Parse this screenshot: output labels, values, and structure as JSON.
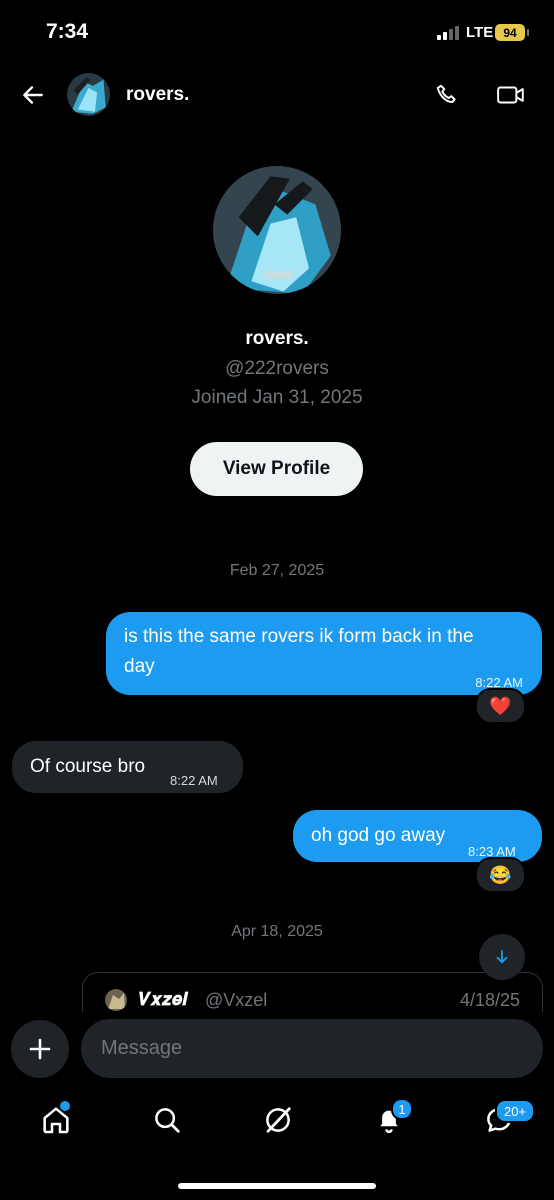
{
  "status_bar": {
    "time": "7:34",
    "network": "LTE",
    "battery": "94"
  },
  "header": {
    "name": "rovers.",
    "back_icon": "arrow-left-icon",
    "call_icon": "phone-icon",
    "video_icon": "video-icon"
  },
  "profile": {
    "name": "rovers.",
    "handle": "@222rovers",
    "joined": "Joined Jan 31, 2025",
    "view_profile_label": "View Profile"
  },
  "messages": [
    {
      "type": "date",
      "text": "Feb 27, 2025"
    },
    {
      "type": "out",
      "line1": "is this the same rovers ik form back in the",
      "line2": "day",
      "time": "8:22 AM",
      "reaction": "❤️"
    },
    {
      "type": "in",
      "text": "Of course bro",
      "time": "8:22 AM"
    },
    {
      "type": "out",
      "text": "oh god go away",
      "time": "8:23 AM",
      "reaction": "😂"
    },
    {
      "type": "date",
      "text": "Apr 18, 2025"
    }
  ],
  "quoted_post": {
    "display_name": "𝑽𝒙𝒛𝒆𝒍",
    "handle": "@Vxzel",
    "date": "4/18/25"
  },
  "composer": {
    "placeholder": "Message"
  },
  "tabs": [
    {
      "name": "home",
      "icon": "home-icon",
      "has_dot": true
    },
    {
      "name": "search",
      "icon": "search-icon"
    },
    {
      "name": "grok",
      "icon": "grok-icon"
    },
    {
      "name": "notifications",
      "icon": "bell-icon",
      "badge": "1"
    },
    {
      "name": "messages",
      "icon": "messages-icon",
      "badge": "20+"
    }
  ],
  "colors": {
    "accent": "#1d9bf0",
    "incoming_bubble": "#202327",
    "muted_text": "#71767b"
  }
}
